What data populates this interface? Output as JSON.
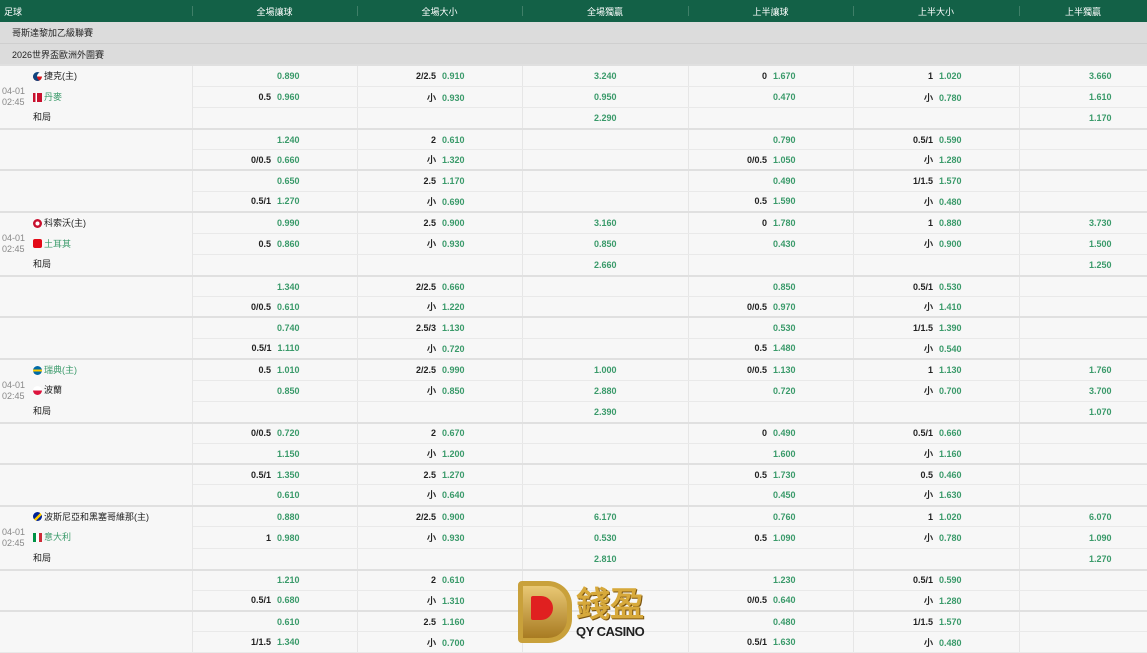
{
  "header": [
    "足球",
    "全場讓球",
    "全場大小",
    "全場獨贏",
    "上半讓球",
    "上半大小",
    "上半獨贏"
  ],
  "leagues": [
    "哥斯達黎加乙級聯賽",
    "2026世界盃歐洲外圍賽"
  ],
  "draw_label": "和局",
  "logo": {
    "cn": "錢盈",
    "en": "QY CASINO"
  },
  "matches": [
    {
      "date": "04-01",
      "time": "02:45",
      "home": {
        "name": "捷克(主)",
        "flag": "czech",
        "fav": false
      },
      "away": {
        "name": "丹麥",
        "flag": "denmark",
        "fav": true
      },
      "rows": [
        [
          [
            "",
            "0.890"
          ],
          [
            "2/2.5",
            "0.910"
          ],
          [
            "",
            "3.240"
          ],
          [
            "0",
            "1.670"
          ],
          [
            "1",
            "1.020"
          ],
          [
            "",
            "3.660"
          ]
        ],
        [
          [
            "0.5",
            "0.960"
          ],
          [
            "小",
            "0.930"
          ],
          [
            "",
            "0.950"
          ],
          [
            "",
            "0.470"
          ],
          [
            "小",
            "0.780"
          ],
          [
            "",
            "1.610"
          ]
        ],
        [
          [
            "",
            ""
          ],
          [
            "",
            ""
          ],
          [
            "",
            "2.290"
          ],
          [
            "",
            ""
          ],
          [
            "",
            ""
          ],
          [
            "",
            "1.170"
          ]
        ],
        [
          [
            "",
            "1.240"
          ],
          [
            "2",
            "0.610"
          ],
          [
            "",
            ""
          ],
          [
            "",
            "0.790"
          ],
          [
            "0.5/1",
            "0.590"
          ],
          [
            "",
            ""
          ]
        ],
        [
          [
            "0/0.5",
            "0.660"
          ],
          [
            "小",
            "1.320"
          ],
          [
            "",
            ""
          ],
          [
            "0/0.5",
            "1.050"
          ],
          [
            "小",
            "1.280"
          ],
          [
            "",
            ""
          ]
        ],
        [
          [
            "",
            "0.650"
          ],
          [
            "2.5",
            "1.170"
          ],
          [
            "",
            ""
          ],
          [
            "",
            "0.490"
          ],
          [
            "1/1.5",
            "1.570"
          ],
          [
            "",
            ""
          ]
        ],
        [
          [
            "0.5/1",
            "1.270"
          ],
          [
            "小",
            "0.690"
          ],
          [
            "",
            ""
          ],
          [
            "0.5",
            "1.590"
          ],
          [
            "小",
            "0.480"
          ],
          [
            "",
            ""
          ]
        ]
      ]
    },
    {
      "date": "04-01",
      "time": "02:45",
      "home": {
        "name": "科索沃(主)",
        "flag": "kosovo",
        "fav": false
      },
      "away": {
        "name": "土耳其",
        "flag": "turkey",
        "fav": true
      },
      "rows": [
        [
          [
            "",
            "0.990"
          ],
          [
            "2.5",
            "0.900"
          ],
          [
            "",
            "3.160"
          ],
          [
            "0",
            "1.780"
          ],
          [
            "1",
            "0.880"
          ],
          [
            "",
            "3.730"
          ]
        ],
        [
          [
            "0.5",
            "0.860"
          ],
          [
            "小",
            "0.930"
          ],
          [
            "",
            "0.850"
          ],
          [
            "",
            "0.430"
          ],
          [
            "小",
            "0.900"
          ],
          [
            "",
            "1.500"
          ]
        ],
        [
          [
            "",
            ""
          ],
          [
            "",
            ""
          ],
          [
            "",
            "2.660"
          ],
          [
            "",
            ""
          ],
          [
            "",
            ""
          ],
          [
            "",
            "1.250"
          ]
        ],
        [
          [
            "",
            "1.340"
          ],
          [
            "2/2.5",
            "0.660"
          ],
          [
            "",
            ""
          ],
          [
            "",
            "0.850"
          ],
          [
            "0.5/1",
            "0.530"
          ],
          [
            "",
            ""
          ]
        ],
        [
          [
            "0/0.5",
            "0.610"
          ],
          [
            "小",
            "1.220"
          ],
          [
            "",
            ""
          ],
          [
            "0/0.5",
            "0.970"
          ],
          [
            "小",
            "1.410"
          ],
          [
            "",
            ""
          ]
        ],
        [
          [
            "",
            "0.740"
          ],
          [
            "2.5/3",
            "1.130"
          ],
          [
            "",
            ""
          ],
          [
            "",
            "0.530"
          ],
          [
            "1/1.5",
            "1.390"
          ],
          [
            "",
            ""
          ]
        ],
        [
          [
            "0.5/1",
            "1.110"
          ],
          [
            "小",
            "0.720"
          ],
          [
            "",
            ""
          ],
          [
            "0.5",
            "1.480"
          ],
          [
            "小",
            "0.540"
          ],
          [
            "",
            ""
          ]
        ]
      ]
    },
    {
      "date": "04-01",
      "time": "02:45",
      "home": {
        "name": "瑞典(主)",
        "flag": "sweden",
        "fav": true
      },
      "away": {
        "name": "波蘭",
        "flag": "poland",
        "fav": false
      },
      "rows": [
        [
          [
            "0.5",
            "1.010"
          ],
          [
            "2/2.5",
            "0.990"
          ],
          [
            "",
            "1.000"
          ],
          [
            "0/0.5",
            "1.130"
          ],
          [
            "1",
            "1.130"
          ],
          [
            "",
            "1.760"
          ]
        ],
        [
          [
            "",
            "0.850"
          ],
          [
            "小",
            "0.850"
          ],
          [
            "",
            "2.880"
          ],
          [
            "",
            "0.720"
          ],
          [
            "小",
            "0.700"
          ],
          [
            "",
            "3.700"
          ]
        ],
        [
          [
            "",
            ""
          ],
          [
            "",
            ""
          ],
          [
            "",
            "2.390"
          ],
          [
            "",
            ""
          ],
          [
            "",
            ""
          ],
          [
            "",
            "1.070"
          ]
        ],
        [
          [
            "0/0.5",
            "0.720"
          ],
          [
            "2",
            "0.670"
          ],
          [
            "",
            ""
          ],
          [
            "0",
            "0.490"
          ],
          [
            "0.5/1",
            "0.660"
          ],
          [
            "",
            ""
          ]
        ],
        [
          [
            "",
            "1.150"
          ],
          [
            "小",
            "1.200"
          ],
          [
            "",
            ""
          ],
          [
            "",
            "1.600"
          ],
          [
            "小",
            "1.160"
          ],
          [
            "",
            ""
          ]
        ],
        [
          [
            "0.5/1",
            "1.350"
          ],
          [
            "2.5",
            "1.270"
          ],
          [
            "",
            ""
          ],
          [
            "0.5",
            "1.730"
          ],
          [
            "0.5",
            "0.460"
          ],
          [
            "",
            ""
          ]
        ],
        [
          [
            "",
            "0.610"
          ],
          [
            "小",
            "0.640"
          ],
          [
            "",
            ""
          ],
          [
            "",
            "0.450"
          ],
          [
            "小",
            "1.630"
          ],
          [
            "",
            ""
          ]
        ]
      ]
    },
    {
      "date": "04-01",
      "time": "02:45",
      "home": {
        "name": "波斯尼亞和黑塞哥維那(主)",
        "flag": "bosnia",
        "fav": false
      },
      "away": {
        "name": "意大利",
        "flag": "italy",
        "fav": true
      },
      "rows": [
        [
          [
            "",
            "0.880"
          ],
          [
            "2/2.5",
            "0.900"
          ],
          [
            "",
            "6.170"
          ],
          [
            "",
            "0.760"
          ],
          [
            "1",
            "1.020"
          ],
          [
            "",
            "6.070"
          ]
        ],
        [
          [
            "1",
            "0.980"
          ],
          [
            "小",
            "0.930"
          ],
          [
            "",
            "0.530"
          ],
          [
            "0.5",
            "1.090"
          ],
          [
            "小",
            "0.780"
          ],
          [
            "",
            "1.090"
          ]
        ],
        [
          [
            "",
            ""
          ],
          [
            "",
            ""
          ],
          [
            "",
            "2.810"
          ],
          [
            "",
            ""
          ],
          [
            "",
            ""
          ],
          [
            "",
            "1.270"
          ]
        ],
        [
          [
            "",
            "1.210"
          ],
          [
            "2",
            "0.610"
          ],
          [
            "",
            ""
          ],
          [
            "",
            "1.230"
          ],
          [
            "0.5/1",
            "0.590"
          ],
          [
            "",
            ""
          ]
        ],
        [
          [
            "0.5/1",
            "0.680"
          ],
          [
            "小",
            "1.310"
          ],
          [
            "",
            ""
          ],
          [
            "0/0.5",
            "0.640"
          ],
          [
            "小",
            "1.280"
          ],
          [
            "",
            ""
          ]
        ],
        [
          [
            "",
            "0.610"
          ],
          [
            "2.5",
            "1.160"
          ],
          [
            "",
            ""
          ],
          [
            "",
            "0.480"
          ],
          [
            "1/1.5",
            "1.570"
          ],
          [
            "",
            ""
          ]
        ],
        [
          [
            "1/1.5",
            "1.340"
          ],
          [
            "小",
            "0.700"
          ],
          [
            "",
            ""
          ],
          [
            "0.5/1",
            "1.630"
          ],
          [
            "小",
            "0.480"
          ],
          [
            "",
            ""
          ]
        ]
      ]
    }
  ]
}
